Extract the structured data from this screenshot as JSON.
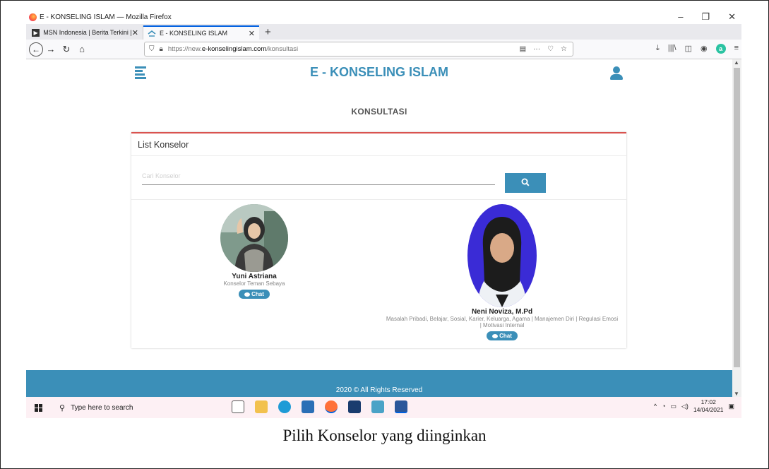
{
  "window": {
    "title": "E - KONSELING ISLAM — Mozilla Firefox",
    "controls": [
      "–",
      "❐",
      "✕"
    ]
  },
  "tabs": [
    {
      "label": "MSN Indonesia | Berita Terkini |",
      "active": false
    },
    {
      "label": "E - KONSELING ISLAM",
      "active": true
    }
  ],
  "url": {
    "prefix": "https://new.",
    "domain": "e-konselingislam.com",
    "path": "/konsultasi"
  },
  "site": {
    "title": "E - KONSELING ISLAM",
    "page_heading": "KONSULTASI",
    "accent_color": "#3b8fb8",
    "card_accent_color": "#d9534f"
  },
  "card": {
    "header": "List Konselor",
    "search_placeholder": "Cari Konselor",
    "search_icon": "search-icon"
  },
  "counselors": [
    {
      "name": "Yuni Astriana",
      "description": "Konselor Teman Sebaya",
      "chat_label": "Chat"
    },
    {
      "name": "Neni Noviza, M.Pd",
      "description": "Masalah Pribadi, Belajar, Sosial, Karier, Keluarga, Agama | Manajemen Diri | Regulasi Emosi | Motivasi Internal",
      "chat_label": "Chat"
    }
  ],
  "footer": {
    "text": "2020 © All Rights Reserved"
  },
  "taskbar": {
    "search_placeholder": "Type here to search",
    "time": "17:02",
    "date": "14/04/2021"
  },
  "caption": "Pilih Konselor yang diinginkan"
}
